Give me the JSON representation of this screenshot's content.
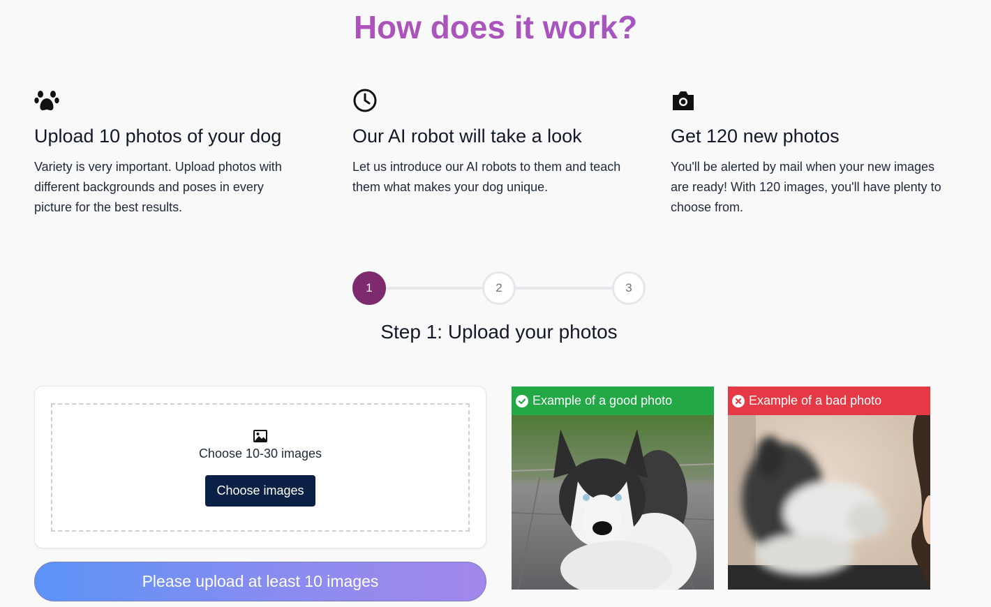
{
  "page": {
    "title": "How does it work?"
  },
  "features": [
    {
      "icon": "paw-icon",
      "title": "Upload 10 photos of your dog",
      "line1": "Variety is very important. Upload photos with",
      "line2": "different backgrounds and poses in every",
      "line3": "picture for the best results."
    },
    {
      "icon": "clock-icon",
      "title": "Our AI robot will take a look",
      "line1": "Let us introduce our AI robots to them and teach",
      "line2": "them what makes your dog unique.",
      "line3": ""
    },
    {
      "icon": "camera-icon",
      "title": "Get 120 new photos",
      "line1": "You'll be alerted by mail when your new images",
      "line2": "are ready! With 120 images, you'll have plenty to",
      "line3": "choose from."
    }
  ],
  "stepper": {
    "steps": [
      "1",
      "2",
      "3"
    ],
    "active": "1",
    "title": "Step 1: Upload your photos"
  },
  "upload": {
    "icon": "image-icon",
    "hint": "Choose 10-30 images",
    "button_label": "Choose images",
    "submit_label": "Please upload at least 10 images"
  },
  "examples": {
    "good": {
      "label": "Example of a good photo",
      "icon": "check-circle-icon",
      "color": "#22a845"
    },
    "bad": {
      "label": "Example of a bad photo",
      "icon": "x-circle-icon",
      "color": "#e63946"
    }
  },
  "colors": {
    "title_gradient": [
      "#b74fb0",
      "#9b59c9"
    ],
    "active_step": "#7e2a6e",
    "primary_button": "#0b2045",
    "submit_gradient": [
      "#5b93f6",
      "#a287ec"
    ]
  }
}
